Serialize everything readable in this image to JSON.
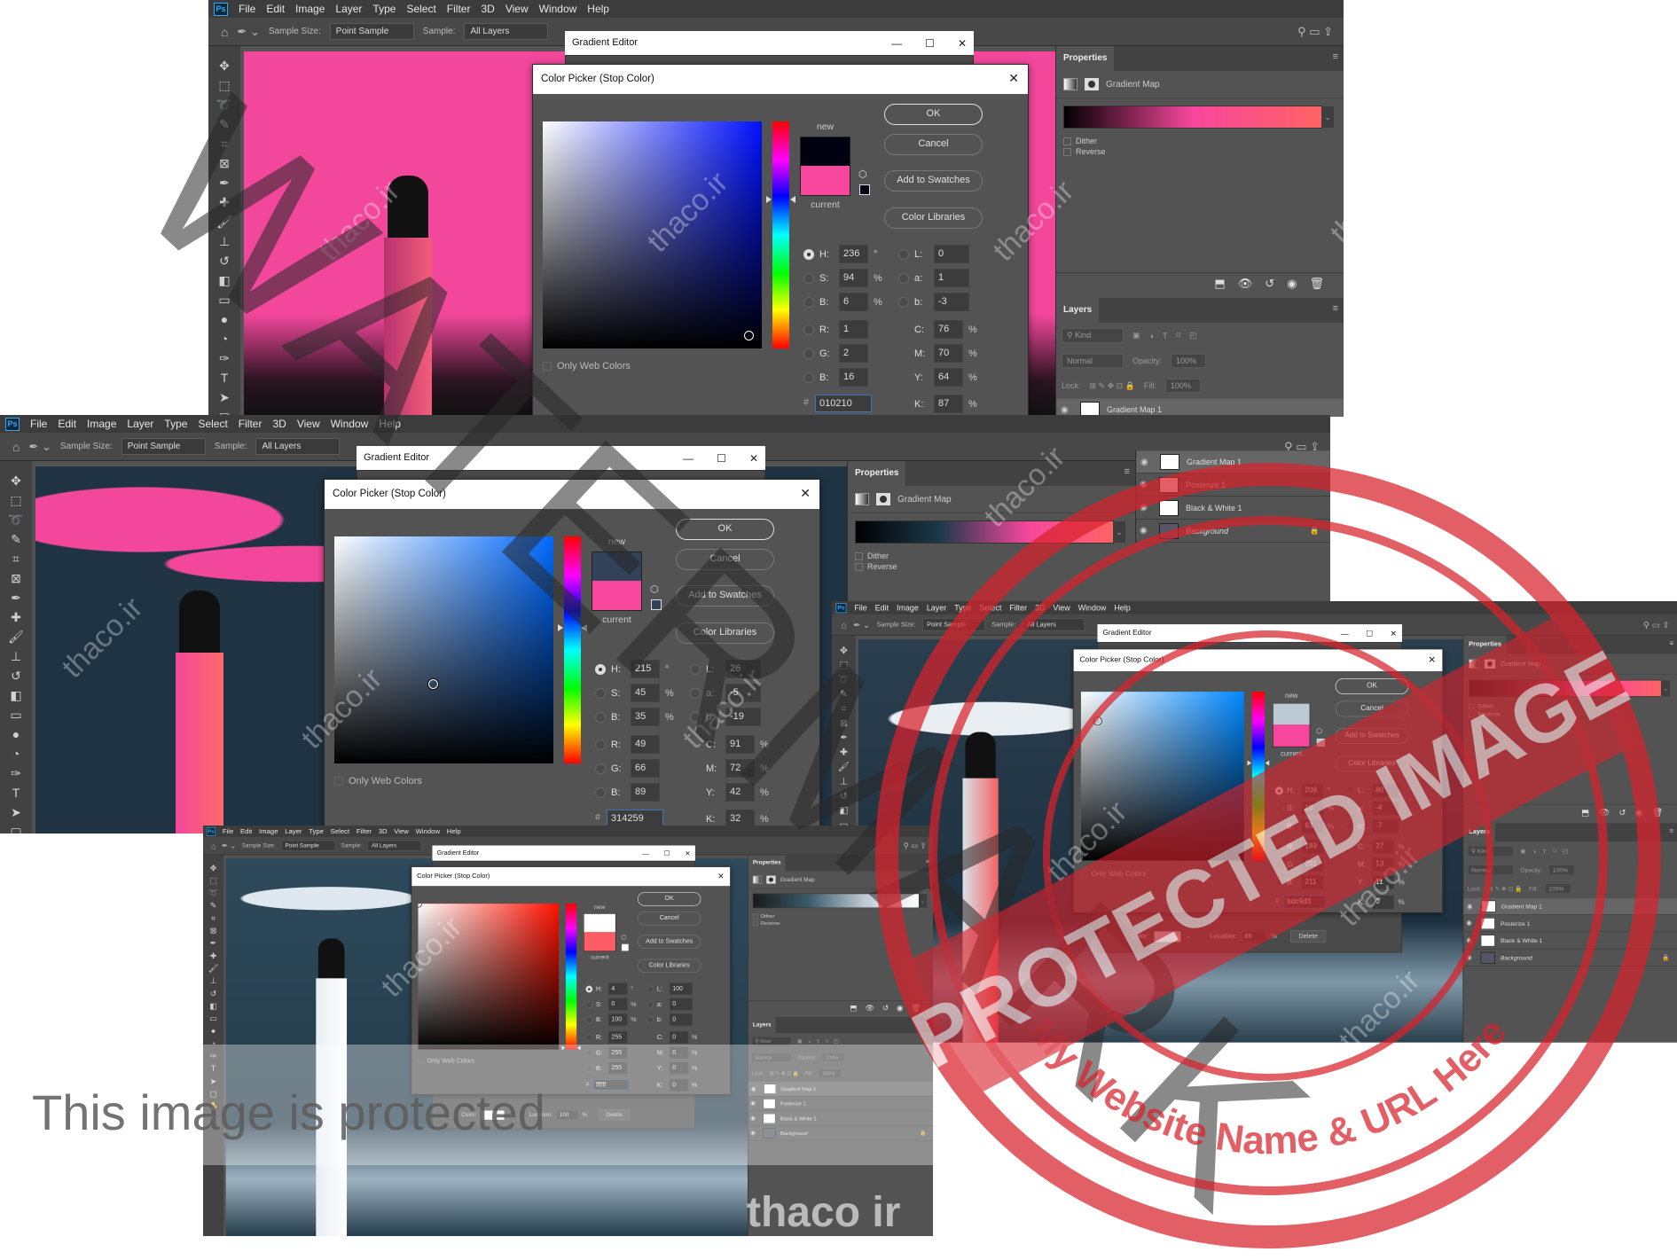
{
  "photoshop": {
    "logo": "Ps",
    "menu": [
      "File",
      "Edit",
      "Image",
      "Layer",
      "Type",
      "Select",
      "Filter",
      "3D",
      "View",
      "Window",
      "Help"
    ],
    "options": {
      "sample_size_label": "Sample Size:",
      "sample_size": "Point Sample",
      "sample_label": "Sample:",
      "sample": "All Layers"
    },
    "tools": [
      "move-icon",
      "marquee-icon",
      "lasso-icon",
      "quick-select-icon",
      "crop-icon",
      "frame-icon",
      "eyedropper-icon",
      "healing-icon",
      "brush-icon",
      "stamp-icon",
      "history-brush-icon",
      "eraser-icon",
      "gradient-icon",
      "blur-icon",
      "dodge-icon",
      "pen-icon",
      "type-icon",
      "path-select-icon",
      "rectangle-icon",
      "hand-icon",
      "zoom-icon"
    ]
  },
  "gradient_editor": {
    "title": "Gradient Editor",
    "color_label": "Color:",
    "location_label": "Location:",
    "percent": "%",
    "delete": "Delete"
  },
  "properties": {
    "title": "Properties",
    "type": "Gradient Map",
    "dither": "Dither",
    "reverse": "Reverse"
  },
  "layers": {
    "title": "Layers",
    "filter": "Kind",
    "blend": "Normal",
    "opacity_label": "Opacity:",
    "opacity": "100%",
    "lock_label": "Lock:",
    "fill_label": "Fill:",
    "fill": "100%",
    "items": [
      "Gradient Map 1",
      "Posterize 1",
      "Black & White 1",
      "Background"
    ]
  },
  "gradient_maps": [
    [
      "#000000",
      "#f7479d",
      "#ff6363"
    ],
    [
      "#000000",
      "#1c3a4a",
      "#f7479d",
      "#ff6363"
    ],
    [
      "#1a1a1a",
      "#6a3a4a",
      "#f7479d",
      "#ff6363"
    ],
    [
      "#1a1a1a",
      "#3a5a6a",
      "#bdc9d3",
      "#ffffff"
    ]
  ],
  "picker_labels": {
    "title": "Color Picker (Stop Color)",
    "new": "new",
    "current": "current",
    "ok": "OK",
    "cancel": "Cancel",
    "add_swatches": "Add to Swatches",
    "libraries": "Color Libraries",
    "only_web": "Only Web Colors",
    "hash": "#",
    "degree": "°",
    "percent": "%",
    "H": "H:",
    "S": "S:",
    "Bv": "B:",
    "L": "L:",
    "a": "a:",
    "b": "b:",
    "R": "R:",
    "G": "G:",
    "Bc": "B:",
    "C": "C:",
    "M": "M:",
    "Y": "Y:",
    "K": "K:"
  },
  "pickers": [
    {
      "H": "236",
      "S": "94",
      "Bv": "6",
      "L": "0",
      "a": "1",
      "b": "-3",
      "R": "1",
      "G": "2",
      "Bc": "16",
      "C": "76",
      "M": "70",
      "Y": "64",
      "K": "87",
      "hex": "010210",
      "current_color": "#f7479d"
    },
    {
      "H": "215",
      "S": "45",
      "Bv": "35",
      "L": "26",
      "a": "-5",
      "b": "-19",
      "R": "49",
      "G": "66",
      "Bc": "89",
      "C": "91",
      "M": "72",
      "Y": "42",
      "K": "32",
      "hex": "314259",
      "current_color": "#f7479d"
    },
    {
      "H": "208",
      "S": "10",
      "Bv": "83",
      "L": "80",
      "a": "-4",
      "b": "-7",
      "R": "189",
      "G": "201",
      "Bc": "211",
      "C": "27",
      "M": "13",
      "Y": "11",
      "K": "0",
      "hex": "bdc9d3",
      "current_color": "#f7479d",
      "location": "66"
    },
    {
      "H": "4",
      "S": "0",
      "Bv": "100",
      "L": "100",
      "a": "0",
      "b": "0",
      "R": "255",
      "G": "255",
      "Bc": "255",
      "C": "0",
      "M": "0",
      "Y": "0",
      "K": "0",
      "hex": "ffffff",
      "current_color": "#fd5d66",
      "location": "100"
    }
  ],
  "watermarks": {
    "site": "thaco.ir",
    "big": "WATERMARK",
    "stamp_main": "PROTECTED IMAGE",
    "stamp_arc": "My Website Name & URL Here",
    "notice": "This image is protected",
    "logo": "thaco ir"
  },
  "colors": {
    "accent_pink": "#f7479d",
    "stamp_red": "#d9222c",
    "panel_bg": "#535353"
  }
}
